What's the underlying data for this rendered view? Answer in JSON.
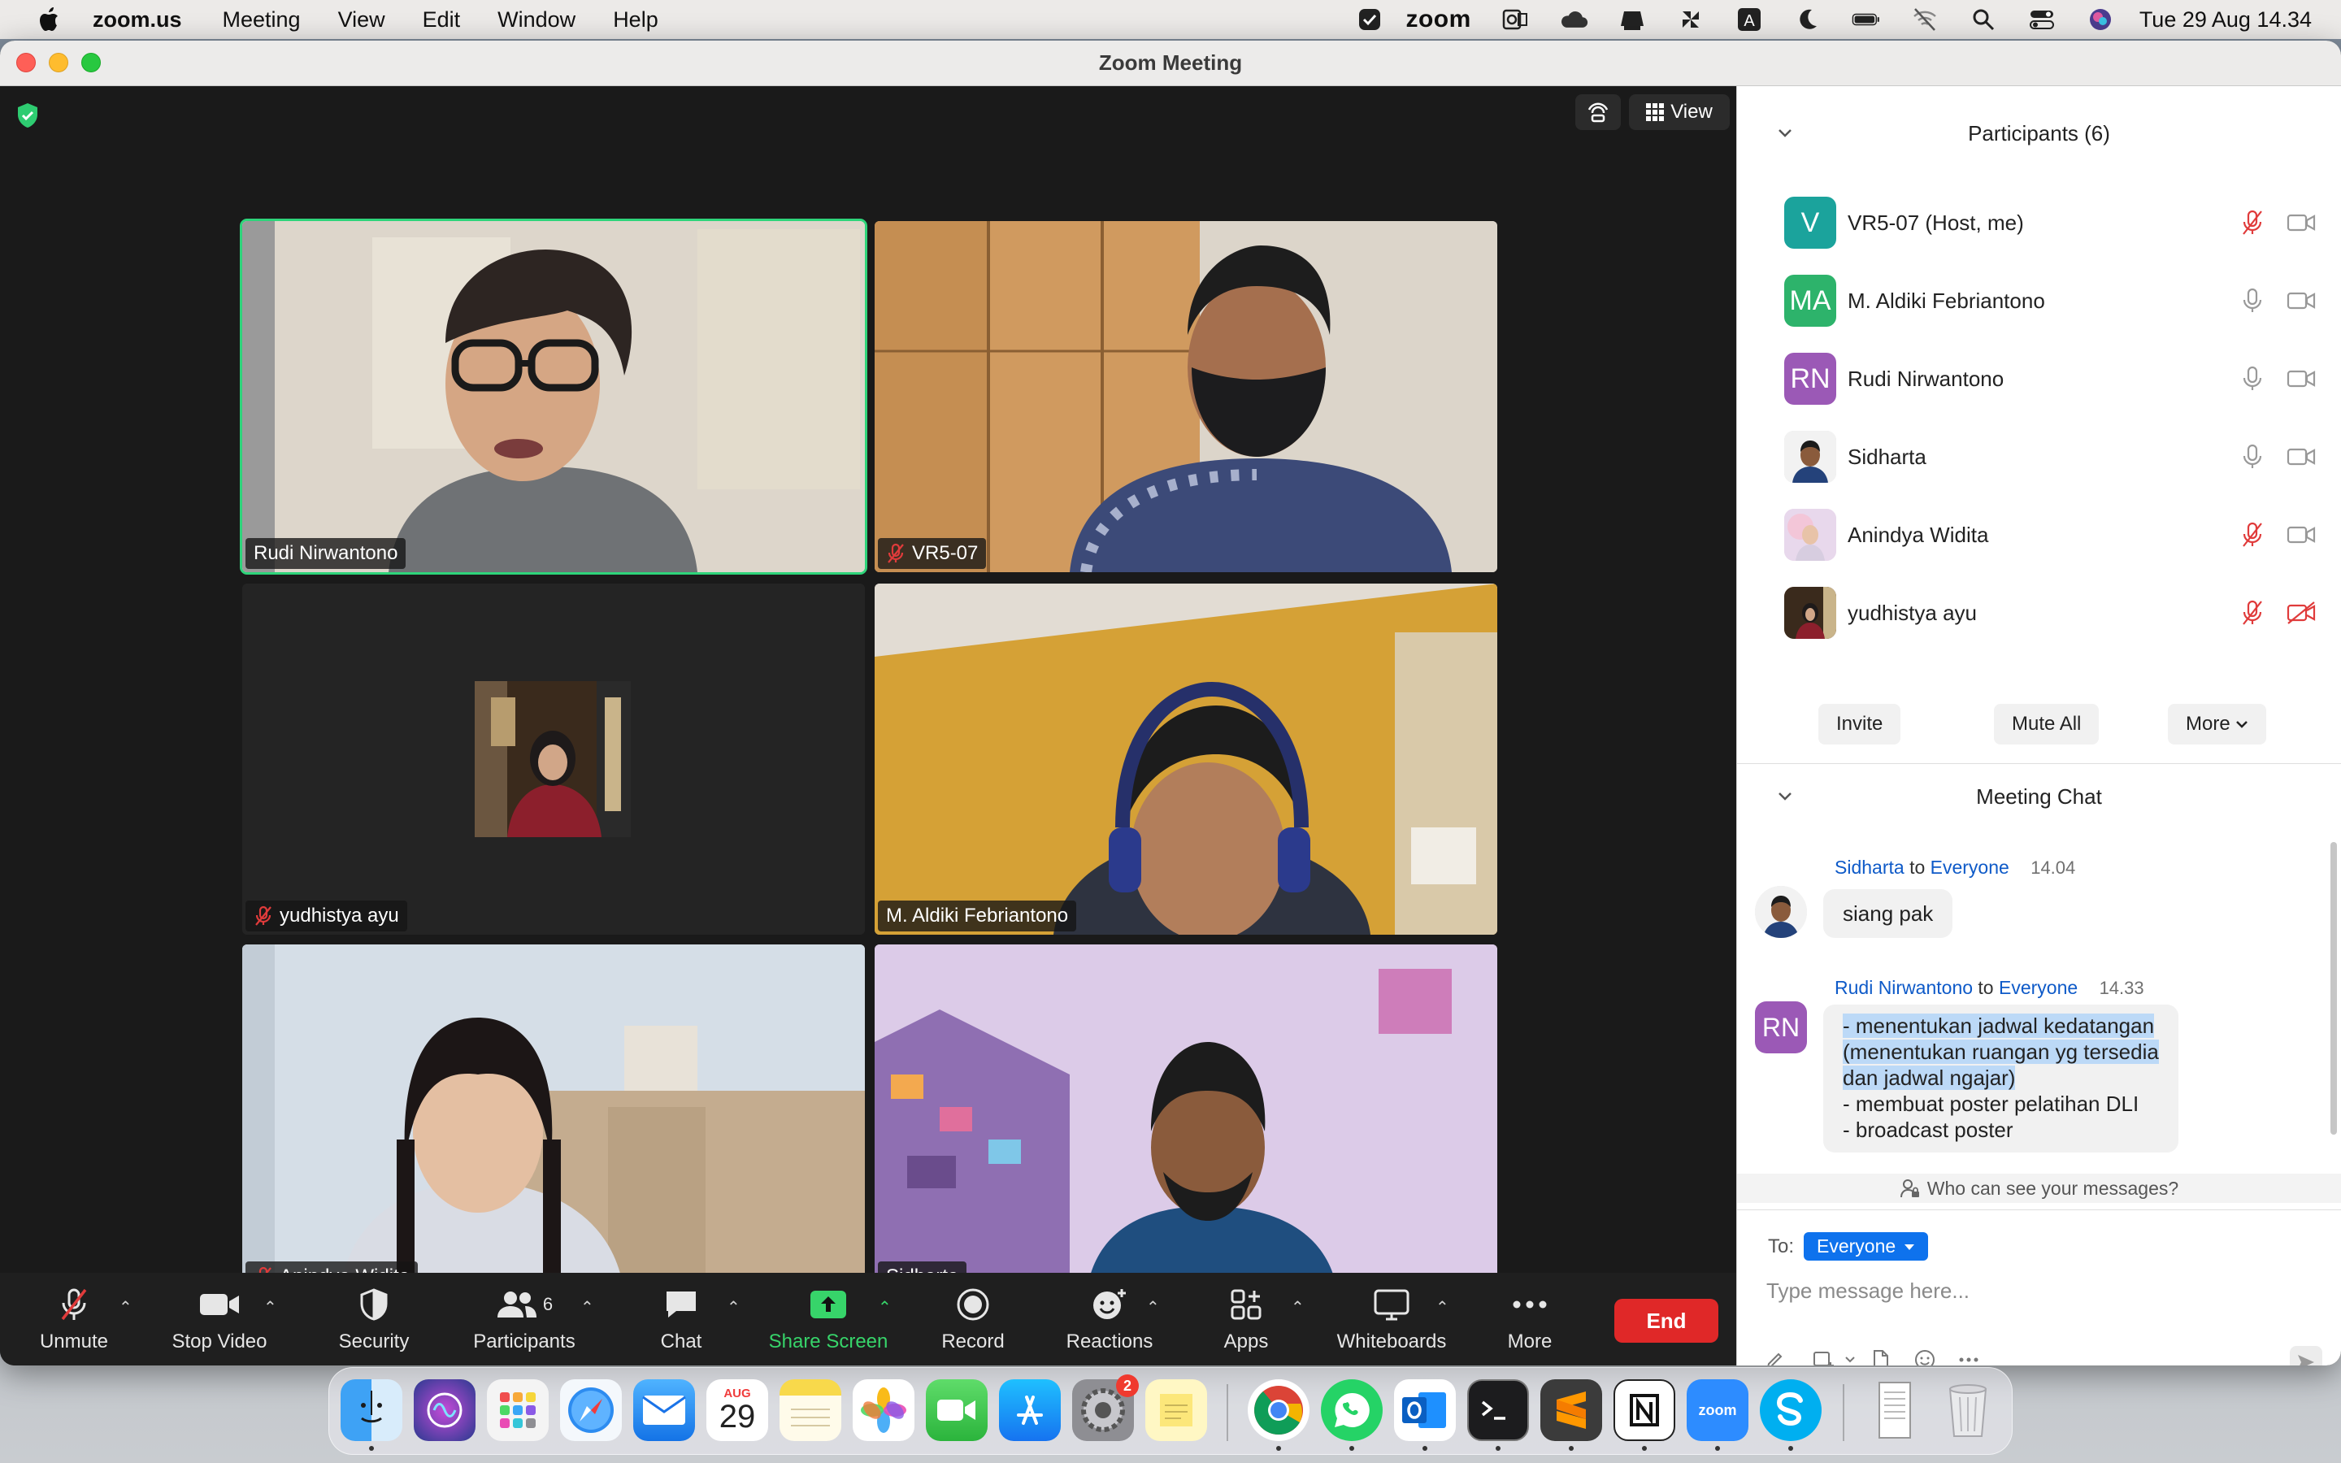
{
  "menubar": {
    "app_name": "zoom.us",
    "menus": [
      "Meeting",
      "View",
      "Edit",
      "Window",
      "Help"
    ],
    "zoom_word": "zoom",
    "clock": "Tue 29 Aug  14.34"
  },
  "window": {
    "title": "Zoom Meeting"
  },
  "video": {
    "view_label": "View",
    "tiles": [
      {
        "name": "Rudi Nirwantono",
        "muted": false,
        "active": true
      },
      {
        "name": "VR5-07",
        "muted": true,
        "active": false
      },
      {
        "name": "yudhistya ayu",
        "muted": true,
        "active": false
      },
      {
        "name": "M. Aldiki Febriantono",
        "muted": false,
        "active": false
      },
      {
        "name": "Anindya Widita",
        "muted": true,
        "active": false
      },
      {
        "name": "Sidharta",
        "muted": false,
        "active": false
      }
    ]
  },
  "toolbar": {
    "unmute": "Unmute",
    "stop_video": "Stop Video",
    "security": "Security",
    "participants": "Participants",
    "participants_count": "6",
    "chat": "Chat",
    "share_screen": "Share Screen",
    "record": "Record",
    "reactions": "Reactions",
    "apps": "Apps",
    "whiteboards": "Whiteboards",
    "more": "More",
    "end": "End"
  },
  "participants_panel": {
    "title": "Participants (6)",
    "items": [
      {
        "initials": "V",
        "name": "VR5-07 (Host, me)",
        "color": "#1ba39c",
        "mic_muted": true,
        "cam_off": false
      },
      {
        "initials": "MA",
        "name": "M. Aldiki Febriantono",
        "color": "#2db36b",
        "mic_muted": false,
        "cam_off": false
      },
      {
        "initials": "RN",
        "name": "Rudi Nirwantono",
        "color": "#9b59b6",
        "mic_muted": false,
        "cam_off": false
      },
      {
        "initials": "",
        "name": "Sidharta",
        "color": "#dddddd",
        "mic_muted": false,
        "cam_off": false
      },
      {
        "initials": "",
        "name": "Anindya Widita",
        "color": "#e7d7ea",
        "mic_muted": true,
        "cam_off": false
      },
      {
        "initials": "",
        "name": "yudhistya ayu",
        "color": "#b07a5a",
        "mic_muted": true,
        "cam_off": true
      }
    ],
    "invite": "Invite",
    "mute_all": "Mute All",
    "more": "More"
  },
  "chat_panel": {
    "title": "Meeting Chat",
    "to_word": "to",
    "messages": [
      {
        "sender": "Sidharta",
        "recipient": "Everyone",
        "time": "14.04",
        "lines": [
          "siang pak"
        ]
      },
      {
        "sender": "Rudi Nirwantono",
        "initials": "RN",
        "recipient": "Everyone",
        "time": "14.33",
        "highlighted": [
          "- menentukan jadwal kedatangan",
          "(menentukan ruangan yg tersedia",
          "dan jadwal ngajar)"
        ],
        "lines": [
          "- membuat poster pelatihan DLI",
          "- broadcast poster"
        ]
      }
    ],
    "who_can_see": "Who can see your messages?",
    "to_label": "To:",
    "recipient": "Everyone",
    "placeholder": "Type message here..."
  },
  "dock": {
    "calendar_month": "AUG",
    "calendar_day": "29",
    "settings_badge": "2",
    "zoom_label": "zoom"
  }
}
